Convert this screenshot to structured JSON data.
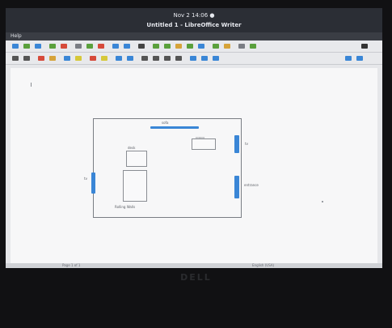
{
  "system": {
    "clock": "Nov 2 14:06 ●"
  },
  "window": {
    "title": "Untitled 1 - LibreOffice Writer"
  },
  "menu": {
    "help": "Help"
  },
  "floorplan": {
    "top_label": "sofa",
    "right_top_label": "tv",
    "left_label": "tv",
    "right_bottom_label": "entrance",
    "inner_label": "desk",
    "bottom_label": "Rolling Walls"
  },
  "status": {
    "left": "Page 1 of 1",
    "right": "English (USA)"
  },
  "bezel": {
    "brand": "DELL"
  },
  "colors": {
    "wall_marker": "#3a86d6"
  }
}
